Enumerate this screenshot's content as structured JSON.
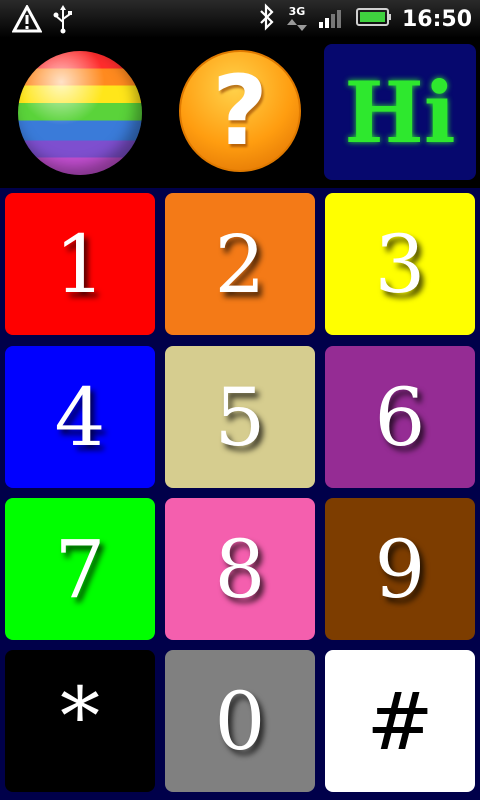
{
  "status_bar": {
    "clock": "16:50",
    "network_label": "3G",
    "icons": [
      "warning-icon",
      "usb-icon",
      "bluetooth-icon",
      "signal-icon",
      "battery-icon"
    ]
  },
  "top_row": {
    "hi_label": "Hi",
    "help_label": "?"
  },
  "keypad": {
    "keys": [
      "1",
      "2",
      "3",
      "4",
      "5",
      "6",
      "7",
      "8",
      "9",
      "*",
      "0",
      "#"
    ]
  },
  "colors": {
    "key_1": "#ff0000",
    "key_2": "#f47a17",
    "key_3": "#ffff00",
    "key_4": "#0000ff",
    "key_5": "#d6cd8f",
    "key_6": "#952c94",
    "key_7": "#00ff00",
    "key_8": "#f45fae",
    "key_9": "#7d3d00",
    "key_star": "#000000",
    "key_0": "#808080",
    "key_hash": "#ffffff",
    "keypad_background": "#00004a",
    "hi_background": "#06086e",
    "hi_text": "#2ee82e"
  }
}
